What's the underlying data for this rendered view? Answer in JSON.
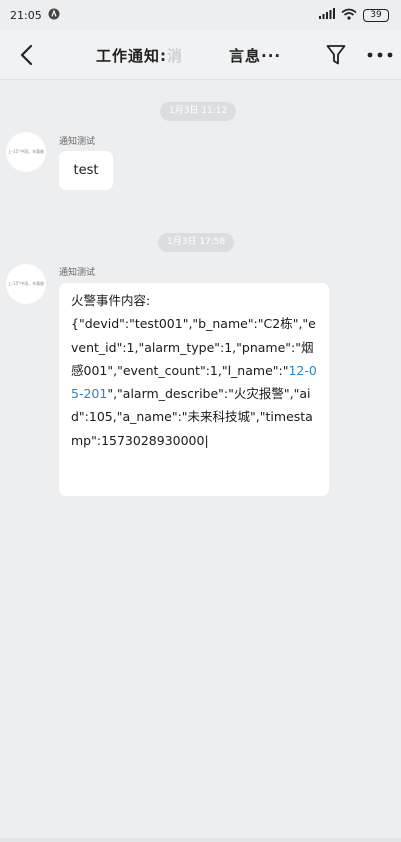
{
  "status": {
    "time": "21:05",
    "battery": "39"
  },
  "header": {
    "title_main": "工作通知:",
    "title_mid": "消",
    "title_tail": "言息···"
  },
  "messages": [
    {
      "timestamp": "1月3日 11:12",
      "sender": "通知测试",
      "avatar_text": "上-15°中雨，车载能",
      "text": "test"
    },
    {
      "timestamp": "1月3日 17:58",
      "sender": "通知测试",
      "avatar_text": "上-15°中雨，车载能",
      "text_before": "火警事件内容:\n{\"devid\":\"test001\",\"b_name\":\"C2栋\",\"event_id\":1,\"alarm_type\":1,\"pname\":\"烟感001\",\"event_count\":1,\"l_name\":\"",
      "link": "12-05-201",
      "text_after": "\",\"alarm_describe\":\"火灾报警\",\"aid\":105,\"a_name\":\"未来科技城\",\"timestamp\":1573028930000|"
    }
  ],
  "colors": {
    "background": "#edeef0",
    "link": "#2f84c9",
    "bubble": "#ffffff"
  },
  "icons": {
    "back": "chevron-left-icon",
    "filter": "filter-icon",
    "more": "more-dots-icon"
  }
}
